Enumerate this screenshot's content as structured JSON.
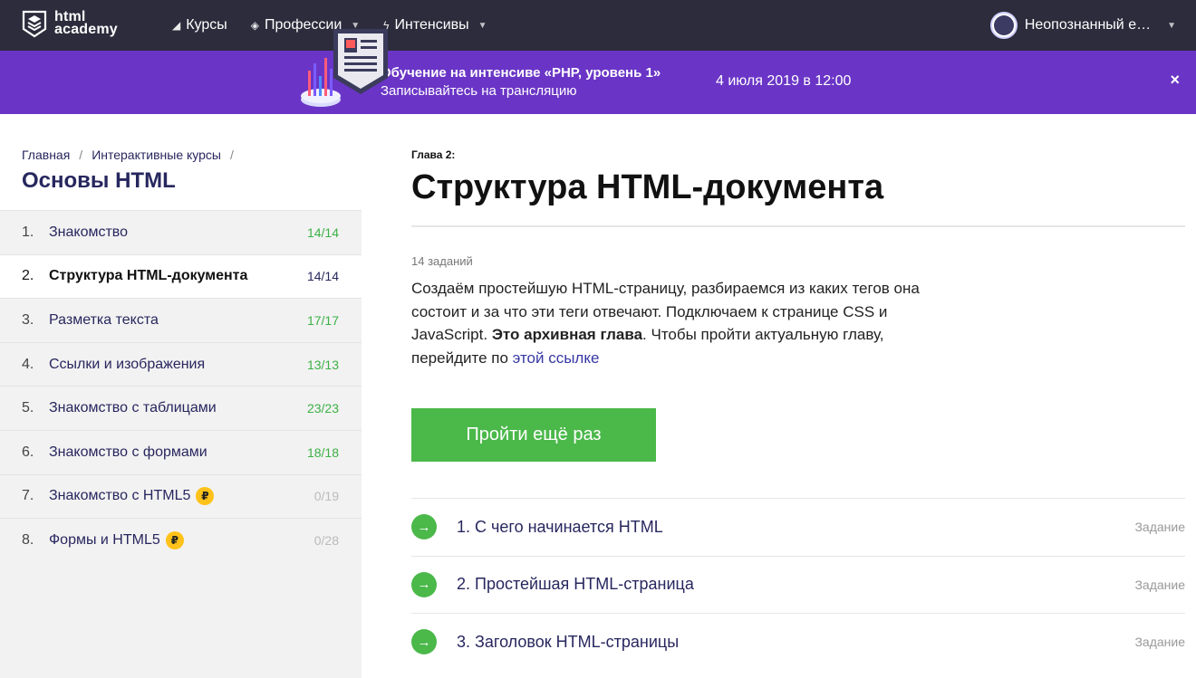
{
  "header": {
    "logo_line1": "html",
    "logo_line2": "academy",
    "nav": [
      {
        "icon": "bar-icon",
        "label": "Курсы"
      },
      {
        "icon": "mortarboard-icon",
        "label": "Профессии"
      },
      {
        "icon": "lightning-icon",
        "label": "Интенсивы"
      }
    ],
    "user_name": "Неопознанный е…"
  },
  "banner": {
    "title": "Обучение на интенсиве «PHP, уровень 1»",
    "subtitle": "Записывайтесь на трансляцию",
    "date": "4 июля 2019 в 12:00",
    "close": "×"
  },
  "sidebar": {
    "breadcrumb": [
      "Главная",
      "Интерактивные курсы"
    ],
    "course_title": "Основы HTML",
    "chapters": [
      {
        "num": "1.",
        "title": "Знакомство",
        "count": "14/14",
        "paid": false
      },
      {
        "num": "2.",
        "title": "Структура HTML-документа",
        "count": "14/14",
        "paid": false
      },
      {
        "num": "3.",
        "title": "Разметка текста",
        "count": "17/17",
        "paid": false
      },
      {
        "num": "4.",
        "title": "Ссылки и изображения",
        "count": "13/13",
        "paid": false
      },
      {
        "num": "5.",
        "title": "Знакомство с таблицами",
        "count": "23/23",
        "paid": false
      },
      {
        "num": "6.",
        "title": "Знакомство с формами",
        "count": "18/18",
        "paid": false
      },
      {
        "num": "7.",
        "title": "Знакомство с HTML5",
        "count": "0/19",
        "paid": true
      },
      {
        "num": "8.",
        "title": "Формы и HTML5",
        "count": "0/28",
        "paid": true
      }
    ],
    "active_index": 1,
    "ruble_sign": "₽"
  },
  "main": {
    "chapter_label": "Глава 2:",
    "title": "Структура HTML-документа",
    "tasks_count": "14 заданий",
    "desc_part1": "Создаём простейшую HTML-страницу, разбираемся из каких тегов она состоит и за что эти теги отвечают. Подключаем к странице CSS и JavaScript. ",
    "desc_bold": "Это архивная глава",
    "desc_part2": ". Чтобы пройти актуальную главу, перейдите по ",
    "desc_link": "этой ссылке",
    "retry_button": "Пройти ещё раз",
    "lessons": [
      {
        "title": "1. С чего начинается HTML",
        "type": "Задание"
      },
      {
        "title": "2. Простейшая HTML-страница",
        "type": "Задание"
      },
      {
        "title": "3. Заголовок HTML-страницы",
        "type": "Задание"
      }
    ]
  },
  "colors": {
    "topbar": "#2c2c3c",
    "banner": "#6a35c6",
    "accent_green": "#4bb84a",
    "link_blue": "#27275f"
  }
}
